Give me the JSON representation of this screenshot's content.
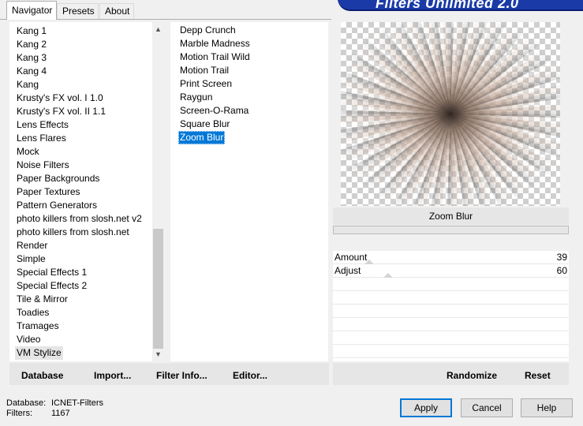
{
  "tabs": [
    {
      "label": "Navigator",
      "active": true
    },
    {
      "label": "Presets",
      "active": false
    },
    {
      "label": "About",
      "active": false
    }
  ],
  "banner": {
    "text": "Filters Unlimited 2.0"
  },
  "categories": [
    "Kang 1",
    "Kang 2",
    "Kang 3",
    "Kang 4",
    "Kang",
    "Krusty's FX vol. I 1.0",
    "Krusty's FX vol. II 1.1",
    "Lens Effects",
    "Lens Flares",
    "Mock",
    "Noise Filters",
    "Paper Backgrounds",
    "Paper Textures",
    "Pattern Generators",
    "photo killers from slosh.net v2",
    "photo killers from slosh.net",
    "Render",
    "Simple",
    "Special Effects 1",
    "Special Effects 2",
    "Tile & Mirror",
    "Toadies",
    "Tramages",
    "Video",
    "VM Stylize"
  ],
  "selected_category": "VM Stylize",
  "filters": [
    "Depp Crunch",
    "Marble Madness",
    "Motion Trail Wild",
    "Motion Trail",
    "Print Screen",
    "Raygun",
    "Screen-O-Rama",
    "Square Blur",
    "Zoom Blur"
  ],
  "selected_filter": "Zoom Blur",
  "preview": {
    "filter_name": "Zoom Blur"
  },
  "params": [
    {
      "label": "Amount",
      "value": "39",
      "level": 39
    },
    {
      "label": "Adjust",
      "value": "60",
      "level": 60
    }
  ],
  "left_buttons": {
    "database": "Database",
    "import": "Import...",
    "filter_info": "Filter Info...",
    "editor": "Editor..."
  },
  "right_buttons": {
    "randomize": "Randomize",
    "reset": "Reset"
  },
  "info": {
    "database_label": "Database:",
    "database_value": "ICNET-Filters",
    "filters_label": "Filters:",
    "filters_value": "1167"
  },
  "dialog_buttons": {
    "apply": "Apply",
    "cancel": "Cancel",
    "help": "Help"
  },
  "colors": {
    "selection": "#0078d7",
    "banner": "#1a3aa8"
  },
  "icons": {
    "scroll_up": "chevron-up-icon",
    "scroll_down": "chevron-down-icon"
  }
}
